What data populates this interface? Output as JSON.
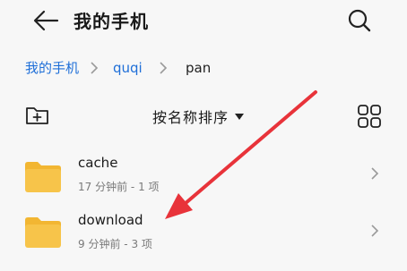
{
  "header": {
    "title": "我的手机"
  },
  "breadcrumb": {
    "items": [
      {
        "label": "我的手机"
      },
      {
        "label": "quqi"
      },
      {
        "label": "pan"
      }
    ]
  },
  "toolbar": {
    "sort_label": "按名称排序"
  },
  "files": [
    {
      "name": "cache",
      "age": "17 分钟前",
      "sep": "-",
      "count": "1 项"
    },
    {
      "name": "download",
      "age": "9 分钟前",
      "sep": "-",
      "count": "3 项"
    }
  ],
  "colors": {
    "accent": "#1f6fd8",
    "folder": "#f7c44a",
    "folder_tab": "#f2b632",
    "annotation": "#e8333a"
  },
  "icons": [
    "back-arrow-icon",
    "search-icon",
    "new-folder-icon",
    "caret-down-icon",
    "grid-view-icon",
    "folder-icon",
    "chevron-right-icon"
  ]
}
